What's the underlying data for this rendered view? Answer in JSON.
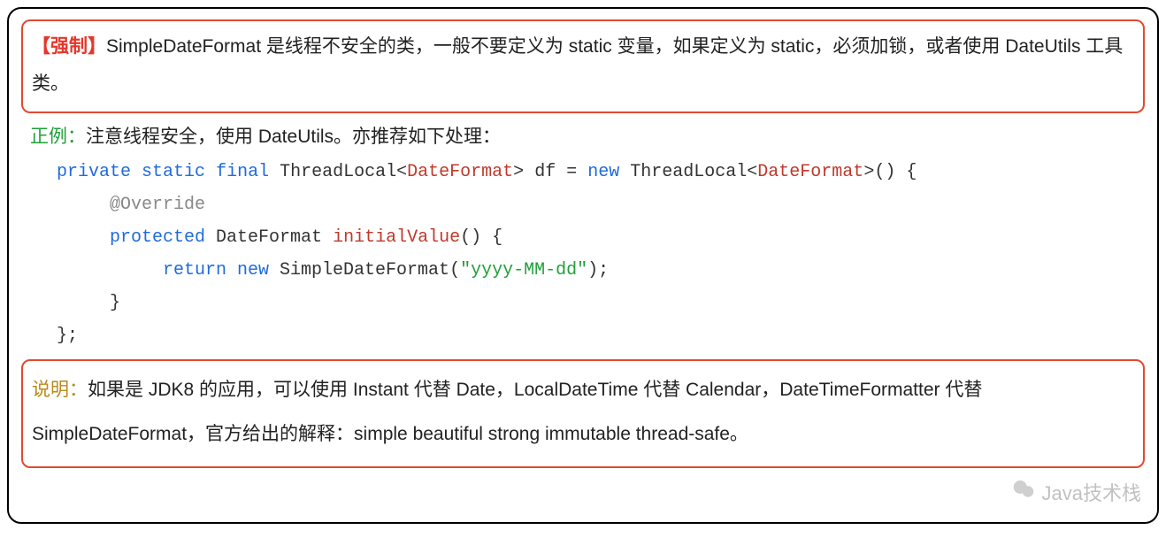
{
  "rule": {
    "tag": "【强制】",
    "text": "SimpleDateFormat  是线程不安全的类，一般不要定义为 static 变量，如果定义为 static，必须加锁，或者使用 DateUtils 工具类。"
  },
  "example": {
    "tag": "正例：",
    "text": "注意线程安全，使用 DateUtils。亦推荐如下处理："
  },
  "code": {
    "l1": {
      "kw1": "private",
      "kw2": "static",
      "kw3": "final",
      "t1": "ThreadLocal",
      "lt": "<",
      "dt1": "DateFormat",
      "gt": "> ",
      "var": "df ",
      "eq": "= ",
      "kw4": "new ",
      "t2": "ThreadLocal",
      "lt2": "<",
      "dt2": "DateFormat",
      "gt2": ">",
      "tail": "() {"
    },
    "l2": {
      "anno": "@Override"
    },
    "l3": {
      "kw1": "protected ",
      "t1": "DateFormat ",
      "m": "initialValue",
      "par": "() {"
    },
    "l4": {
      "kw1": "return ",
      "kw2": "new ",
      "t1": "SimpleDateFormat",
      "op": "(",
      "str": "\"yyyy-MM-dd\"",
      "cl": ");"
    },
    "l5": "}",
    "l6": "};"
  },
  "note": {
    "tag": "说明：",
    "text": "如果是 JDK8 的应用，可以使用 Instant 代替 Date，LocalDateTime 代替 Calendar，DateTimeFormatter 代替 SimpleDateFormat，官方给出的解释：simple beautiful strong immutable thread-safe。"
  },
  "watermark": "Java技术栈"
}
